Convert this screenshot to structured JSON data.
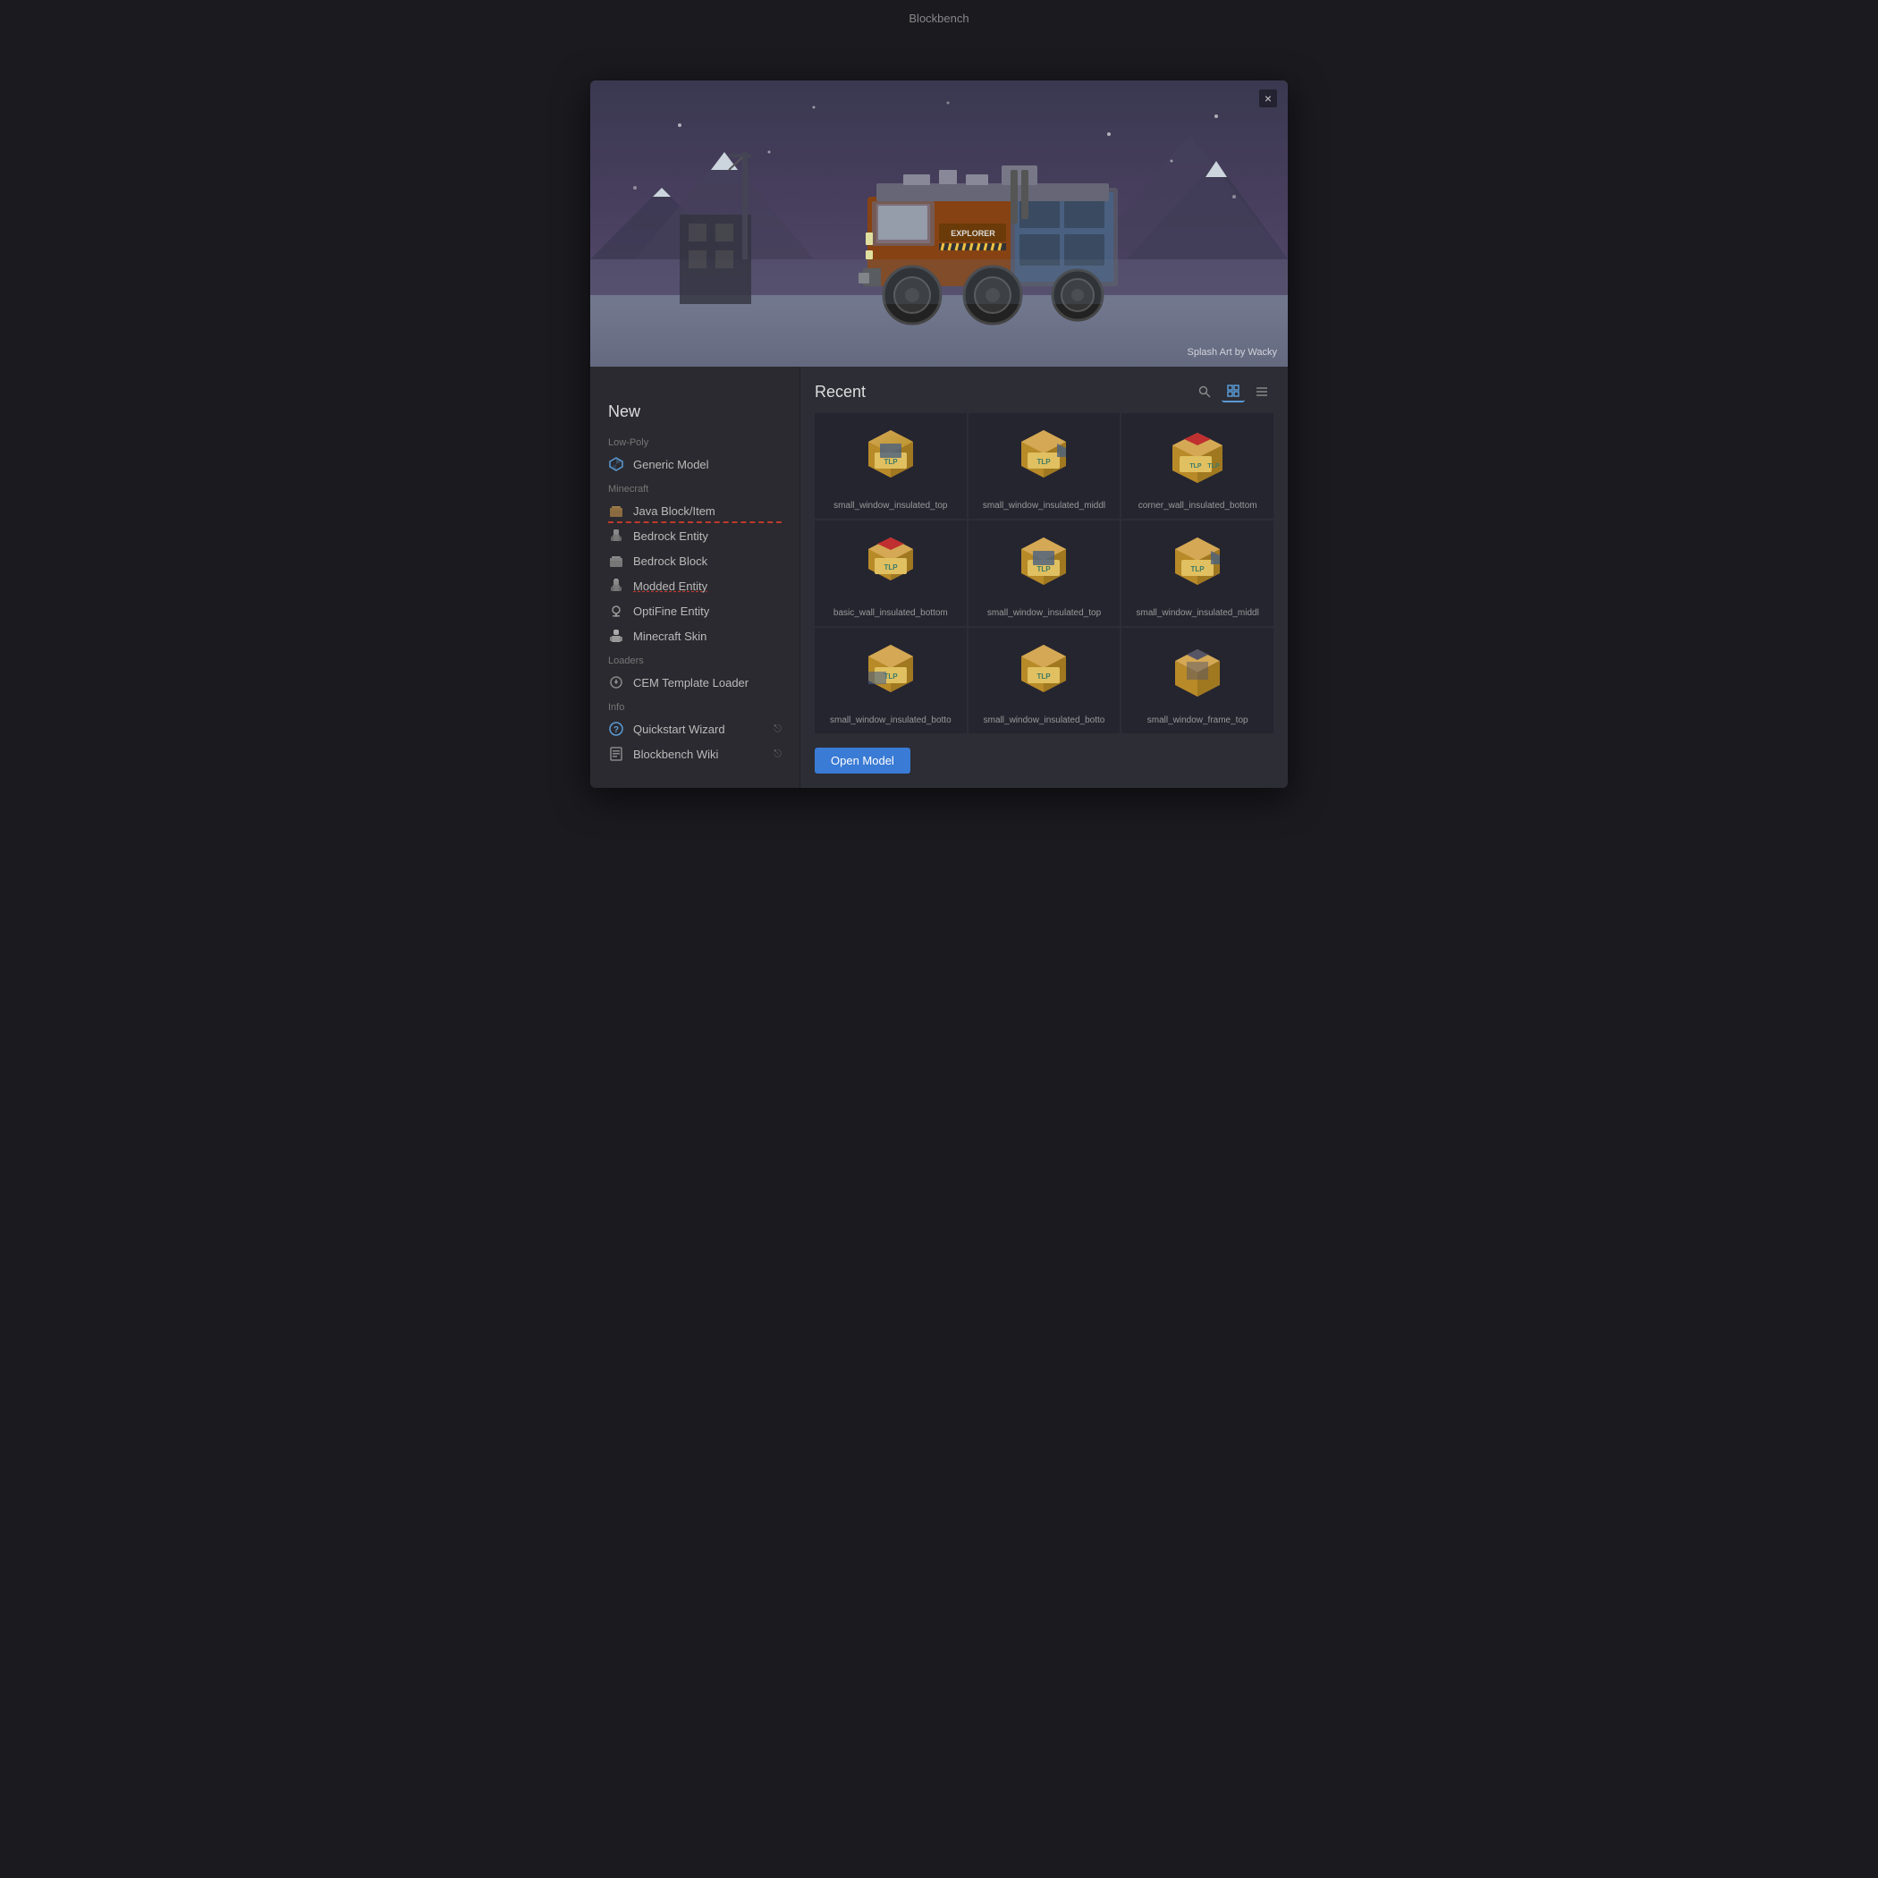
{
  "titleBar": {
    "title": "Blockbench"
  },
  "dialog": {
    "closeBtn": "×",
    "splashCredit": "Splash Art by Wacky"
  },
  "sidebar": {
    "newTitle": "New",
    "sections": [
      {
        "title": "Low-Poly",
        "items": [
          {
            "id": "generic-model",
            "icon": "diamond",
            "label": "Generic Model",
            "hasUnderline": false,
            "hasExternal": false
          }
        ]
      },
      {
        "title": "Minecraft",
        "items": [
          {
            "id": "java-block",
            "icon": "java",
            "label": "Java Block/Item",
            "hasUnderline": true,
            "hasExternal": false
          },
          {
            "id": "bedrock-entity",
            "icon": "bedrock",
            "label": "Bedrock Entity",
            "hasUnderline": false,
            "hasExternal": false
          },
          {
            "id": "bedrock-block",
            "icon": "bedrock-block",
            "label": "Bedrock Block",
            "hasUnderline": false,
            "hasExternal": false
          },
          {
            "id": "modded-entity",
            "icon": "modded",
            "label": "Modded Entity",
            "hasUnderline": true,
            "hasExternal": false,
            "modded": true
          },
          {
            "id": "optifine-entity",
            "icon": "optifine",
            "label": "OptiFine Entity",
            "hasUnderline": false,
            "hasExternal": false
          },
          {
            "id": "minecraft-skin",
            "icon": "skin",
            "label": "Minecraft Skin",
            "hasUnderline": false,
            "hasExternal": false
          }
        ]
      },
      {
        "title": "Loaders",
        "items": [
          {
            "id": "cem-loader",
            "icon": "loader",
            "label": "CEM Template Loader",
            "hasUnderline": false,
            "hasExternal": false
          }
        ]
      },
      {
        "title": "Info",
        "items": [
          {
            "id": "quickstart",
            "icon": "help",
            "label": "Quickstart Wizard",
            "hasUnderline": false,
            "hasExternal": true
          },
          {
            "id": "wiki",
            "icon": "book",
            "label": "Blockbench Wiki",
            "hasUnderline": false,
            "hasExternal": true
          }
        ]
      }
    ]
  },
  "recent": {
    "title": "Recent",
    "items": [
      {
        "id": "item1",
        "name": "small_window_insulated_top"
      },
      {
        "id": "item2",
        "name": "small_window_insulated_middl"
      },
      {
        "id": "item3",
        "name": "corner_wall_insulated_bottom"
      },
      {
        "id": "item4",
        "name": "basic_wall_insulated_bottom"
      },
      {
        "id": "item5",
        "name": "small_window_insulated_top"
      },
      {
        "id": "item6",
        "name": "small_window_insulated_middl"
      },
      {
        "id": "item7",
        "name": "small_window_insulated_botto"
      },
      {
        "id": "item8",
        "name": "small_window_insulated_botto"
      },
      {
        "id": "item9",
        "name": "small_window_frame_top"
      }
    ],
    "openModelBtn": "Open Model"
  },
  "viewControls": {
    "searchIcon": "🔍",
    "gridIcon": "▦",
    "listIcon": "☰"
  }
}
